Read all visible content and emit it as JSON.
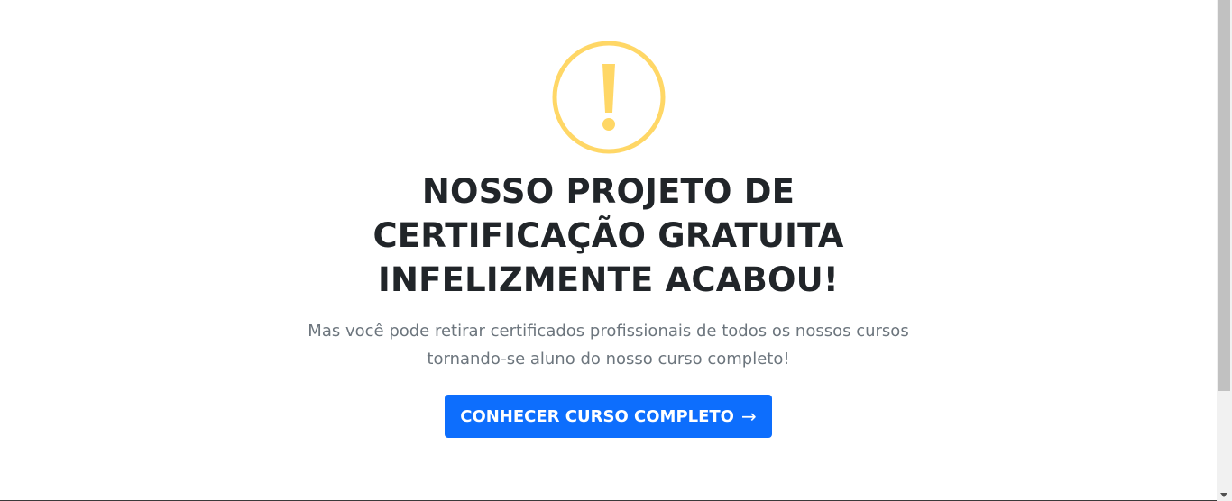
{
  "hero": {
    "icon": "exclamation-circle-icon",
    "icon_color": "#ffd766",
    "title_line1": "NOSSO PROJETO DE",
    "title_line2": "CERTIFICAÇÃO GRATUITA",
    "title_line3": "INFELIZMENTE ACABOU!",
    "subtitle_line1": "Mas você pode retirar certificados profissionais de todos os nossos cursos",
    "subtitle_line2": "tornando-se aluno do nosso curso completo!",
    "cta_label": "CONHECER CURSO COMPLETO",
    "cta_arrow": "→",
    "cta_color": "#0d6efd"
  }
}
